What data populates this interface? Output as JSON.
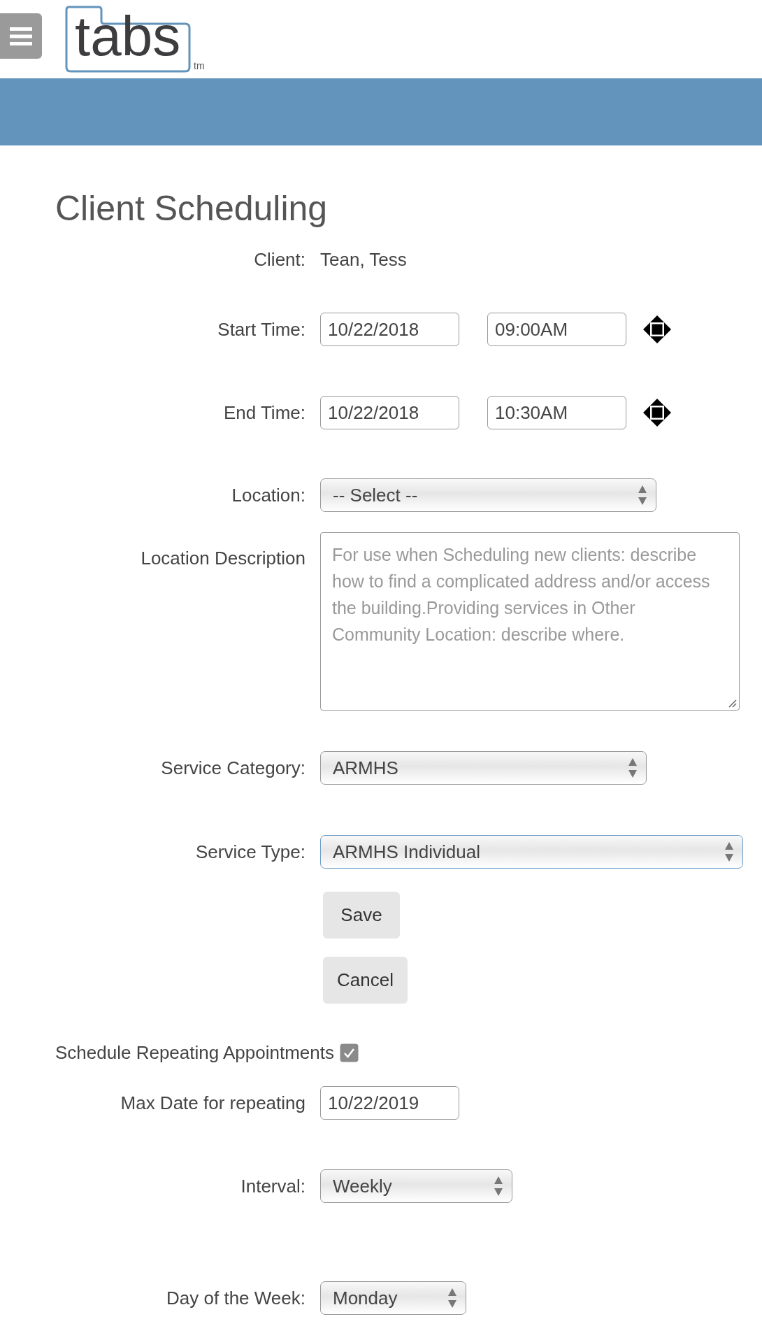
{
  "header": {
    "logo": "tabs",
    "trademark": "tm"
  },
  "title": "Client Scheduling",
  "fields": [
    {
      "kind": "text",
      "label": "Client:",
      "value": "Tean, Tess"
    },
    {
      "kind": "datetime",
      "label": "Start Time:",
      "date": "10/22/2018",
      "time": "09:00AM"
    },
    {
      "kind": "datetime",
      "label": "End Time:",
      "date": "10/22/2018",
      "time": "10:30AM"
    },
    {
      "kind": "select",
      "label": "Location:",
      "value": "-- Select --",
      "focused": false
    },
    {
      "kind": "textarea",
      "label": "Location Description",
      "placeholder": "For use when Scheduling new clients: describe how to find a complicated address and/or access the building.Providing services in Other Community Location: describe where."
    },
    {
      "kind": "select",
      "label": "Service Category:",
      "value": "ARMHS",
      "focused": false
    },
    {
      "kind": "select",
      "label": "Service Type:",
      "value": "ARMHS Individual",
      "focused": true
    },
    {
      "kind": "button",
      "label": "Save"
    },
    {
      "kind": "button",
      "label": "Cancel"
    },
    {
      "kind": "checkbox",
      "label": "Schedule Repeating Appointments",
      "checked": true
    },
    {
      "kind": "date",
      "label": "Max Date for repeating",
      "value": "10/22/2019"
    },
    {
      "kind": "select",
      "label": "Interval:",
      "value": "Weekly",
      "focused": false
    },
    {
      "kind": "select",
      "label": "Day of the Week:",
      "value": "Monday",
      "focused": false
    }
  ]
}
